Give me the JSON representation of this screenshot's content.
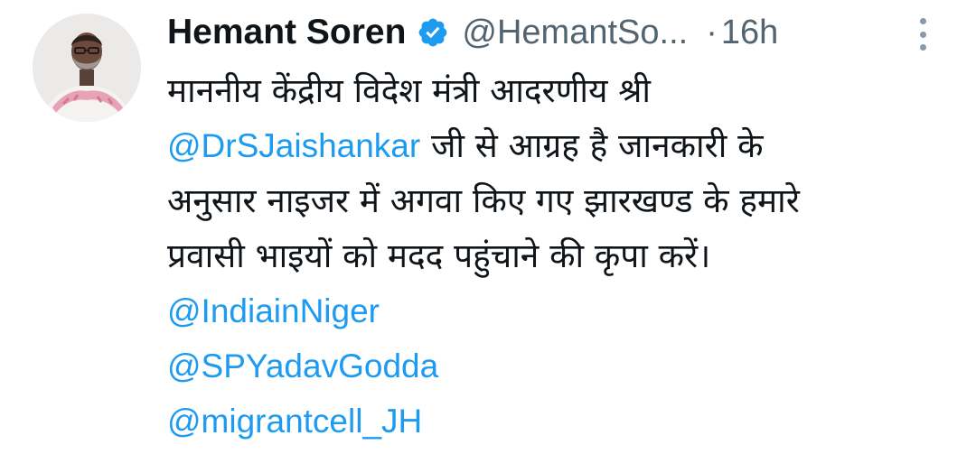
{
  "tweet": {
    "author_name": "Hemant Soren",
    "handle": "@HemantSo...",
    "separator": "·",
    "time": "16h",
    "text": {
      "line1": "माननीय केंद्रीय विदेश मंत्री आदरणीय श्री",
      "line2_mention": "@DrSJaishankar",
      "line2_rest": " जी से आग्रह है जानकारी के",
      "line3": "अनुसार नाइजर में अगवा किए गए झारखण्ड के हमारे",
      "line4": "प्रवासी भाइयों को मदद पहुंचाने की कृपा करें।"
    },
    "mentions": [
      "@IndiainNiger",
      "@SPYadavGodda",
      "@migrantcell_JH"
    ]
  },
  "icons": {
    "verified": "verified-badge-icon",
    "more": "more-options-icon",
    "avatar": "profile-avatar"
  },
  "colors": {
    "link": "#1d9bf0",
    "secondary_text": "#536471",
    "primary_text": "#0f1419",
    "verified": "#1d9bf0"
  }
}
